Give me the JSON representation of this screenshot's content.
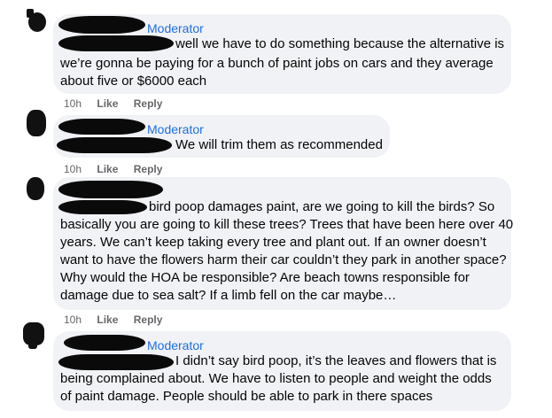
{
  "comments": [
    {
      "badge": "Moderator",
      "lines": [
        "well we have to do something because the alternative is",
        "we’re gonna be paying for a bunch of paint jobs on cars and they average",
        "about five or $6000 each"
      ],
      "time": "10h",
      "like": "Like",
      "reply": "Reply"
    },
    {
      "badge": "Moderator",
      "lines": [
        "We will trim them as recommended"
      ],
      "time": "10h",
      "like": "Like",
      "reply": "Reply"
    },
    {
      "badge": "",
      "lines": [
        "bird poop damages paint, are we going to kill the birds? So",
        "basically you are going to kill these trees? Trees that have been here over 40",
        "years. We can’t keep taking every tree and plant out. If an owner doesn’t",
        "want to have the flowers harm their car couldn’t they park in another space?",
        "Why would the HOA be responsible? Are beach towns responsible for",
        "damage due to sea salt? If a limb fell on the car maybe…"
      ],
      "time": "10h",
      "like": "Like",
      "reply": "Reply"
    },
    {
      "badge": "Moderator",
      "lines": [
        "I didn’t say bird poop, it’s the leaves and flowers that is",
        "being complained about. We have to listen to people and weight the odds",
        "of paint damage. People should be able to park in there spaces"
      ]
    }
  ]
}
